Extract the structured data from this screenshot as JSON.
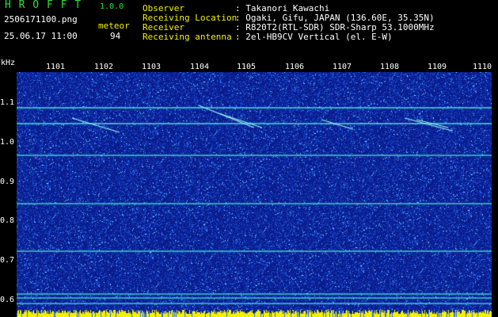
{
  "header": {
    "app_name": "H R O F F T",
    "version": "1.0.0",
    "filename": "2506171100.png",
    "datetime": "25.06.17 11:00",
    "meteor_label": "meteor",
    "meteor_count": "94",
    "info": [
      {
        "label": "Observer",
        "value": ": Takanori Kawachi"
      },
      {
        "label": "Receiving Location",
        "value": ": Ogaki, Gifu, JAPAN (136.60E, 35.35N)"
      },
      {
        "label": "Receiver",
        "value": ": R820T2(RTL-SDR) SDR-Sharp 53.1000MHz"
      },
      {
        "label": "Receiving antenna",
        "value": ": 2el-HB9CV Vertical (el. E-W)"
      }
    ]
  },
  "spectrogram": {
    "y_unit": "kHz",
    "y_ticks": [
      "1.1",
      "1.0",
      "0.9",
      "0.8",
      "0.7",
      "0.6"
    ],
    "x_ticks": [
      "1101",
      "1102",
      "1103",
      "1104",
      "1105",
      "1106",
      "1107",
      "1108",
      "1109",
      "1110"
    ],
    "colors": {
      "background": "#0a1a8a",
      "noise": "#2a70ff",
      "line": "#3ff0f0",
      "bar": "#f3f000"
    }
  }
}
